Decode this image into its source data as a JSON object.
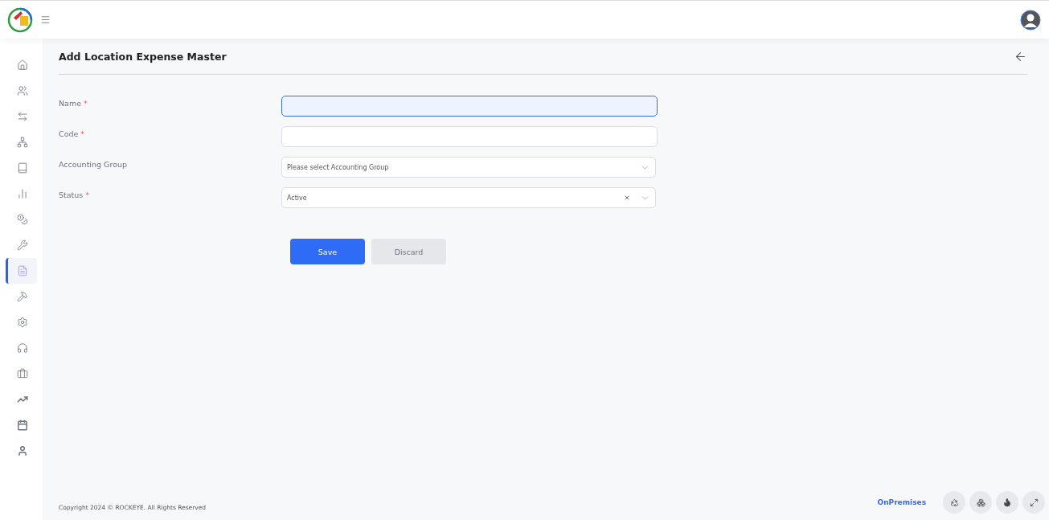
{
  "sidebar": {
    "items": [
      {
        "selected": false
      },
      {
        "selected": false
      },
      {
        "selected": false
      },
      {
        "selected": false
      },
      {
        "selected": false
      },
      {
        "selected": false
      },
      {
        "selected": false
      },
      {
        "selected": false
      },
      {
        "selected": true
      },
      {
        "selected": false
      },
      {
        "selected": false
      },
      {
        "selected": false
      },
      {
        "selected": false
      },
      {
        "selected": false
      },
      {
        "selected": false
      },
      {
        "selected": false
      }
    ]
  },
  "page": {
    "title": "Add Location Expense Master"
  },
  "form": {
    "fields": [
      {
        "kind": "input",
        "label": "Name",
        "mark": "*",
        "focused": true
      },
      {
        "kind": "input",
        "label": "Code",
        "mark": "*",
        "focused": false
      },
      {
        "kind": "select",
        "label": "Accounting Group",
        "placeholder": "Please select Accounting Group",
        "clearable": false
      },
      {
        "kind": "select",
        "label": "Status",
        "mark": "*",
        "value": "Active",
        "clearable": true
      }
    ],
    "buttons": [
      {
        "kind": "primary",
        "label": "Save"
      },
      {
        "kind": "secondary",
        "label": "Discard"
      }
    ]
  },
  "footer": {
    "copyright": "Copyright 2024 © ROCKEYE. All Rights Reserved",
    "mode": "OnPremises"
  }
}
